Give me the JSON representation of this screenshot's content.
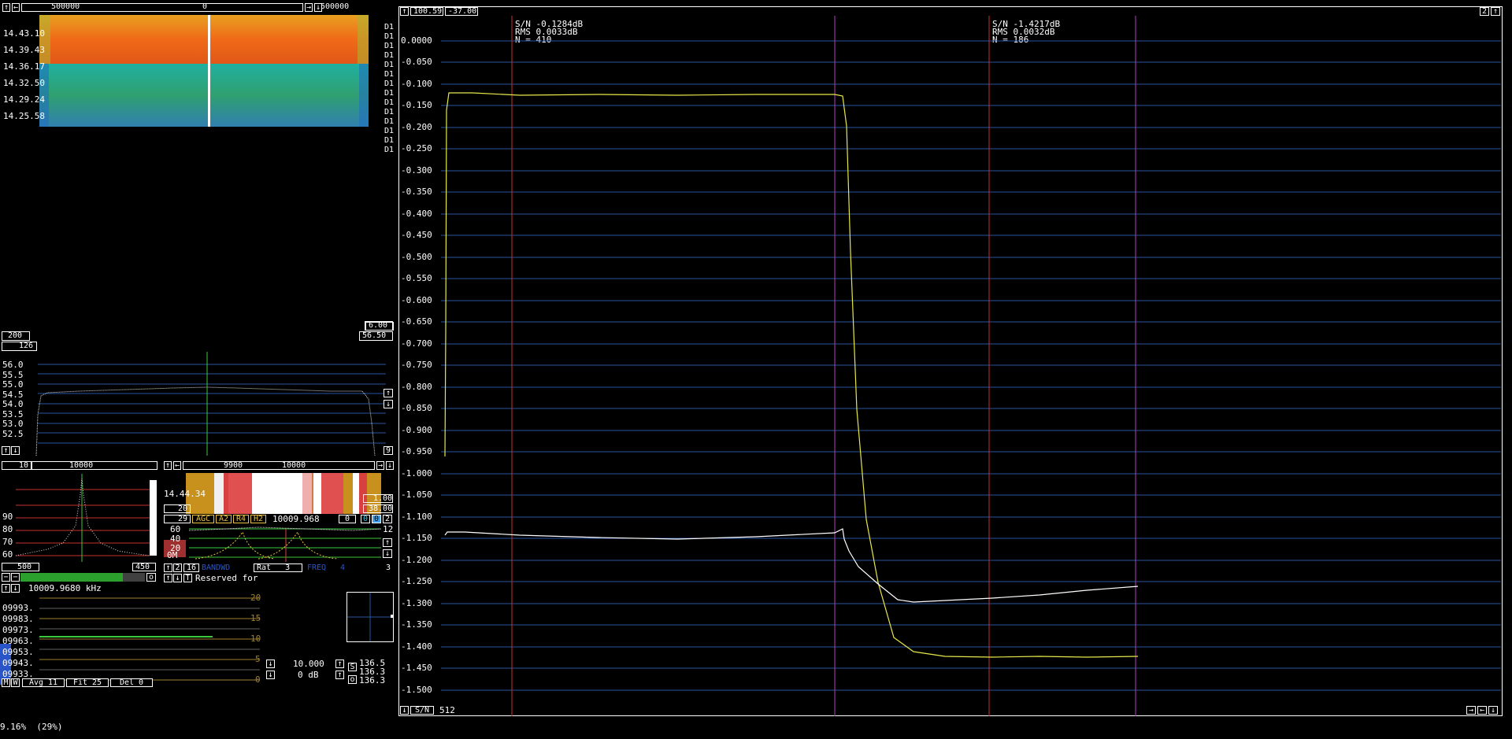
{
  "top_waterfall": {
    "scale_left": "500000",
    "scale_mid": "0",
    "scale_right": "500000",
    "times": [
      "14.43.10",
      "14.39.43",
      "14.36.17",
      "14.32.50",
      "14.29.24",
      "14.25.58"
    ],
    "right_marks": [
      "D1",
      "D1",
      "D1",
      "D1",
      "D1",
      "D1",
      "D1",
      "D1",
      "D1",
      "D1",
      "D1",
      "D1",
      "D1",
      "D1"
    ],
    "val_a": "6.00",
    "val_b": "56.50",
    "val_left": "200"
  },
  "spectrum": {
    "header_val": "126",
    "y_labels": [
      "56.0",
      "55.5",
      "55.0",
      "54.5",
      "54.0",
      "53.5",
      "53.0",
      "52.5"
    ],
    "right_num": "9"
  },
  "small_spectrum": {
    "header_left": "10",
    "header_mid": "10000",
    "y_labels": [
      "90",
      "80",
      "70",
      "60"
    ],
    "bottom_left": "500",
    "bottom_right": "450",
    "bottom_o": "o"
  },
  "mini_waterfall": {
    "scale_left": "9900",
    "scale_right": "10000",
    "time": "14.44.34",
    "val_top": "1.00",
    "val_bot": "38.00",
    "row_left": "20",
    "ctrl_num": "29",
    "agc": "AGC",
    "a2": "A2",
    "r4": "R4",
    "h2": "H2",
    "freq": "10009.968",
    "z1": "0",
    "z2": "0",
    "z3": "0",
    "levels": [
      "60",
      "40",
      "20",
      "0M"
    ],
    "right_12": "12",
    "b_num": "2",
    "b_16": "16",
    "b_bandw": "BANDWD",
    "rat": "Rat",
    "rat_val": "3",
    "b_fm": "FREQ",
    "b_4": "4",
    "right_3": "3",
    "reserved": "Reserved for"
  },
  "freq_panel": {
    "freq_readout": "10009.9680 kHz",
    "freqs": [
      "09993.",
      "09983.",
      "09973.",
      "09963.",
      "09953.",
      "09943.",
      "09933."
    ],
    "scale": [
      "20",
      "15",
      "10",
      "5",
      "0"
    ],
    "bottom": [
      "M",
      "W",
      "Avg 11",
      "Fit 25",
      "Del  0"
    ],
    "step": "10.000",
    "db": "0 dB",
    "readings": [
      "136.5",
      "136.3",
      "136.3"
    ],
    "s_btn": "S",
    "o_btn": "o"
  },
  "main_plot": {
    "hdr_a": "100.59",
    "hdr_b": "-37.00",
    "right_num": "2",
    "stats_left": [
      "S/N -0.1284dB",
      "RMS 0.0033dB",
      "N = 410"
    ],
    "stats_right": [
      "S/N -1.4217dB",
      "RMS 0.0032dB",
      "N = 186"
    ],
    "y_labels": [
      "0.0000",
      "-0.050",
      "-0.100",
      "-0.150",
      "-0.200",
      "-0.250",
      "-0.300",
      "-0.350",
      "-0.400",
      "-0.450",
      "-0.500",
      "-0.550",
      "-0.600",
      "-0.650",
      "-0.700",
      "-0.750",
      "-0.800",
      "-0.850",
      "-0.900",
      "-0.950",
      "-1.000",
      "-1.050",
      "-1.100",
      "-1.150",
      "-1.200",
      "-1.250",
      "-1.300",
      "-1.350",
      "-1.400",
      "-1.450",
      "-1.500"
    ],
    "footer_btn": "S/N",
    "footer_val": "512"
  },
  "status": {
    "text": "9.16%  (29%)"
  },
  "colors": {
    "grid_blue": "#2a55a0",
    "trace_yellow": "#e8e84a",
    "trace_white": "#ffffff",
    "marker_red": "#c83232",
    "marker_purple": "#b040c0",
    "green_line": "#3cc83c"
  },
  "icons": {
    "up_arrow": "up-arrow-icon",
    "left_arrow": "left-arrow-icon",
    "right_arrow": "right-arrow-icon",
    "down_arrow": "down-arrow-icon"
  }
}
